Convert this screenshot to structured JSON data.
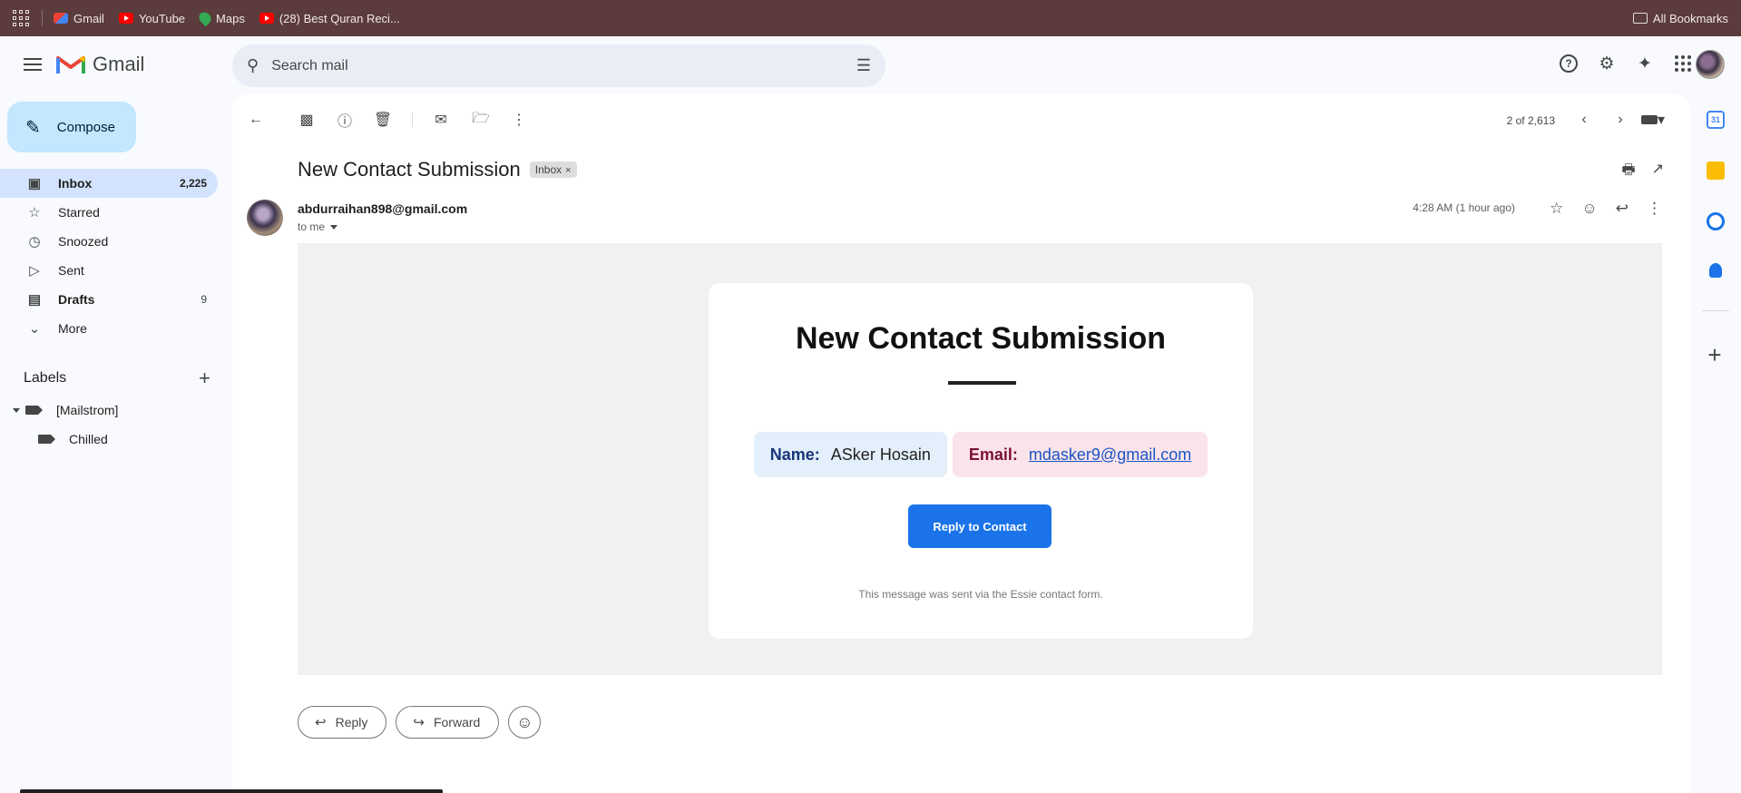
{
  "bookmarks": {
    "items": [
      {
        "label": "Gmail",
        "icon": "gmail-icon"
      },
      {
        "label": "YouTube",
        "icon": "youtube-icon"
      },
      {
        "label": "Maps",
        "icon": "maps-icon"
      },
      {
        "label": "(28) Best Quran Reci...",
        "icon": "youtube-icon"
      }
    ],
    "all_bookmarks": "All Bookmarks"
  },
  "app": {
    "name": "Gmail",
    "compose": "Compose",
    "search_placeholder": "Search mail"
  },
  "nav": {
    "items": [
      {
        "label": "Inbox",
        "count": "2,225",
        "icon": "inbox-icon"
      },
      {
        "label": "Starred",
        "count": "",
        "icon": "star-icon"
      },
      {
        "label": "Snoozed",
        "count": "",
        "icon": "clock-icon"
      },
      {
        "label": "Sent",
        "count": "",
        "icon": "send-icon"
      },
      {
        "label": "Drafts",
        "count": "9",
        "icon": "draft-icon"
      },
      {
        "label": "More",
        "count": "",
        "icon": "chevron-down-icon"
      }
    ]
  },
  "labels": {
    "title": "Labels",
    "items": [
      {
        "label": "[Mailstrom]"
      },
      {
        "label": "Chilled"
      }
    ]
  },
  "toolbar": {
    "pager": "2 of 2,613"
  },
  "message": {
    "subject": "New Contact Submission",
    "chip": "Inbox",
    "sender": "abdurraihan898@gmail.com",
    "to": "to me",
    "time": "4:28 AM (1 hour ago)"
  },
  "email_body": {
    "heading": "New Contact Submission",
    "name_label": "Name:",
    "name_value": "ASker Hosain",
    "email_label": "Email:",
    "email_value": "mdasker9@gmail.com",
    "reply_button": "Reply to Contact",
    "footer": "This message was sent via the Essie contact form."
  },
  "actions": {
    "reply": "Reply",
    "forward": "Forward"
  },
  "side_panel": {
    "calendar_day": "31"
  },
  "colors": {
    "bookmark_bar": "#5b3b3b",
    "compose_bg": "#c2e7ff",
    "active_nav": "#d3e3fd",
    "reply_button": "#1a73e8"
  }
}
